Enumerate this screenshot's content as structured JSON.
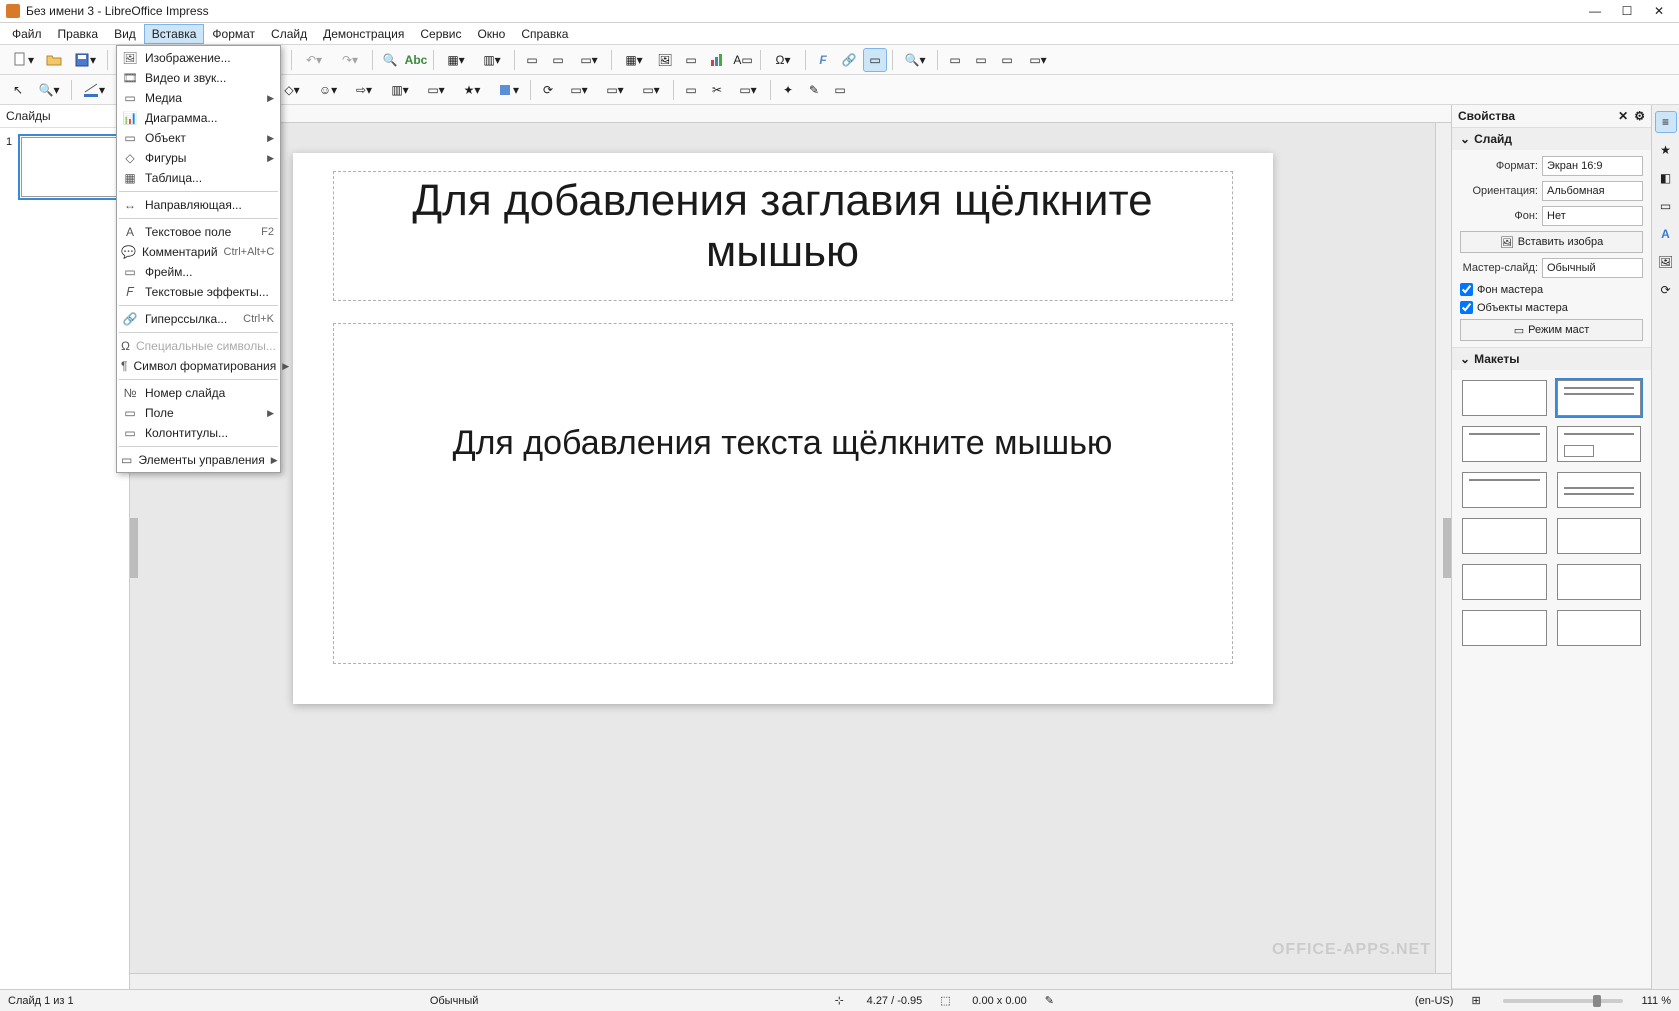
{
  "window": {
    "title": "Без имени 3 - LibreOffice Impress"
  },
  "menubar": {
    "items": [
      "Файл",
      "Правка",
      "Вид",
      "Вставка",
      "Формат",
      "Слайд",
      "Демонстрация",
      "Сервис",
      "Окно",
      "Справка"
    ],
    "open_index": 3
  },
  "insert_menu": {
    "groups": [
      [
        {
          "icon": "image",
          "label": "Изображение...",
          "hasSub": false
        },
        {
          "icon": "av",
          "label": "Видео и звук...",
          "hasSub": false
        },
        {
          "icon": "media",
          "label": "Медиа",
          "hasSub": true
        },
        {
          "icon": "chart",
          "label": "Диаграмма...",
          "hasSub": false
        },
        {
          "icon": "object",
          "label": "Объект",
          "hasSub": true
        },
        {
          "icon": "shapes",
          "label": "Фигуры",
          "hasSub": true
        },
        {
          "icon": "table",
          "label": "Таблица...",
          "hasSub": false
        }
      ],
      [
        {
          "icon": "guide",
          "label": "Направляющая...",
          "hasSub": false
        }
      ],
      [
        {
          "icon": "textbox",
          "label": "Текстовое поле",
          "shortcut": "F2"
        },
        {
          "icon": "comment",
          "label": "Комментарий",
          "shortcut": "Ctrl+Alt+C"
        },
        {
          "icon": "frame",
          "label": "Фрейм...",
          "hasSub": false
        },
        {
          "icon": "fontwork",
          "label": "Текстовые эффекты...",
          "hasSub": false
        }
      ],
      [
        {
          "icon": "link",
          "label": "Гиперссылка...",
          "shortcut": "Ctrl+K"
        }
      ],
      [
        {
          "icon": "specchar",
          "label": "Специальные символы...",
          "disabled": true
        },
        {
          "icon": "formatmark",
          "label": "Символ форматирования",
          "hasSub": true
        }
      ],
      [
        {
          "icon": "slidenum",
          "label": "Номер слайда"
        },
        {
          "icon": "field",
          "label": "Поле",
          "hasSub": true
        },
        {
          "icon": "headerfooter",
          "label": "Колонтитулы...",
          "hasSub": false
        }
      ],
      [
        {
          "icon": "controls",
          "label": "Элементы управления",
          "hasSub": true
        }
      ]
    ]
  },
  "slides_panel": {
    "title": "Слайды",
    "current": 1
  },
  "slide": {
    "title_placeholder": "Для добавления заглавия щёлкните мышью",
    "content_placeholder": "Для добавления текста щёлкните мышью"
  },
  "properties": {
    "panel_title": "Свойства",
    "slide_section": "Слайд",
    "format_label": "Формат:",
    "format_value": "Экран 16:9",
    "orientation_label": "Ориентация:",
    "orientation_value": "Альбомная",
    "background_label": "Фон:",
    "background_value": "Нет",
    "insert_image_btn": "Вставить изобра",
    "master_label": "Мастер-слайд:",
    "master_value": "Обычный",
    "master_bg_chk": "Фон мастера",
    "master_obj_chk": "Объекты мастера",
    "master_mode_btn": "Режим маст",
    "layouts_section": "Макеты"
  },
  "statusbar": {
    "slide_count": "Слайд 1 из 1",
    "template": "Обычный",
    "position": "4.27 / -0.95",
    "size": "0.00 x 0.00",
    "locale": "(en-US)",
    "zoom": "111 %"
  },
  "watermark": "OFFICE-APPS.NET"
}
